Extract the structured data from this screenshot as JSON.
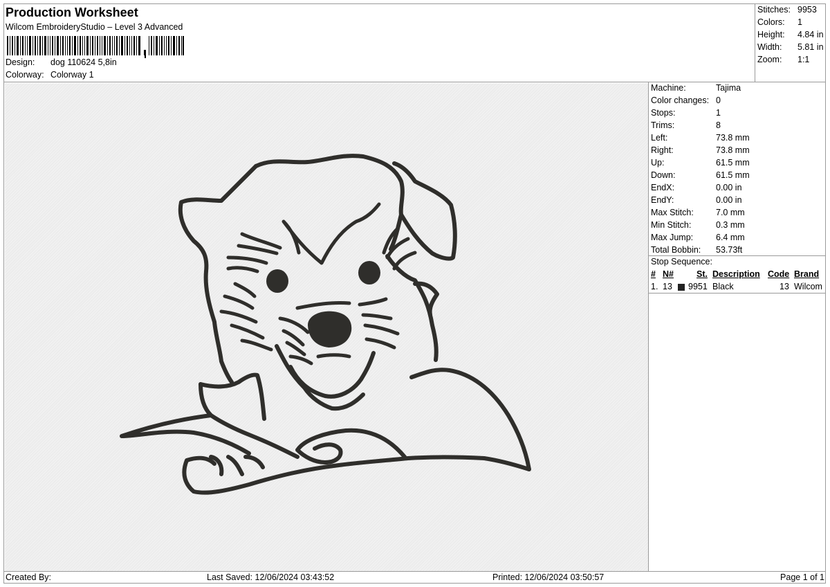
{
  "header": {
    "title": "Production Worksheet",
    "subtitle": "Wilcom EmbroideryStudio – Level 3 Advanced",
    "design_label": "Design:",
    "design_value": "dog 110624 5,8in",
    "colorway_label": "Colorway:",
    "colorway_value": "Colorway 1"
  },
  "summary": {
    "stitches_label": "Stitches:",
    "stitches_value": "9953",
    "colors_label": "Colors:",
    "colors_value": "1",
    "height_label": "Height:",
    "height_value": "4.84 in",
    "width_label": "Width:",
    "width_value": "5.81 in",
    "zoom_label": "Zoom:",
    "zoom_value": "1:1"
  },
  "details": [
    {
      "label": "Machine:",
      "value": "Tajima"
    },
    {
      "label": "Color changes:",
      "value": "0"
    },
    {
      "label": "Stops:",
      "value": "1"
    },
    {
      "label": "Trims:",
      "value": "8"
    },
    {
      "label": "Left:",
      "value": "73.8 mm"
    },
    {
      "label": "Right:",
      "value": "73.8 mm"
    },
    {
      "label": "Up:",
      "value": "61.5 mm"
    },
    {
      "label": "Down:",
      "value": "61.5 mm"
    },
    {
      "label": "EndX:",
      "value": "0.00 in"
    },
    {
      "label": "EndY:",
      "value": "0.00 in"
    },
    {
      "label": "Max Stitch:",
      "value": "7.0 mm"
    },
    {
      "label": "Min Stitch:",
      "value": "0.3 mm"
    },
    {
      "label": "Max Jump:",
      "value": "6.4 mm"
    },
    {
      "label": "Total Bobbin:",
      "value": "53.73ft"
    }
  ],
  "stop_sequence": {
    "title": "Stop Sequence:",
    "columns": [
      "#",
      "N#",
      "St.",
      "Description",
      "Code",
      "Brand"
    ],
    "rows": [
      {
        "index": "1.",
        "n": "13",
        "swatch_color": "#222222",
        "st": "9951",
        "description": "Black",
        "code": "13",
        "brand": "Wilcom"
      }
    ]
  },
  "footer": {
    "created_by": "Created By:",
    "last_saved": "Last Saved: 12/06/2024 03:43:52",
    "printed": "Printed: 12/06/2024 03:50:57",
    "page": "Page 1 of 1"
  },
  "colors": {
    "thread": "#2f2e2b",
    "canvas_bg": "#ececec",
    "grid_line": "#9a9a9a"
  }
}
